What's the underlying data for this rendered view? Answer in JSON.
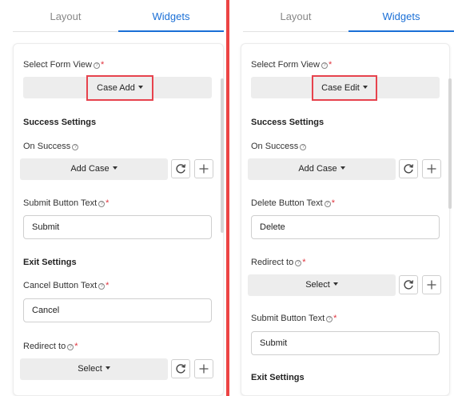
{
  "left": {
    "tabs": [
      {
        "label": "Layout"
      },
      {
        "label": "Widgets"
      }
    ],
    "form_view_label": "Select Form View",
    "form_view_value": "Case Add",
    "success_heading": "Success Settings",
    "on_success_label": "On Success",
    "on_success_value": "Add Case",
    "submit_label": "Submit Button Text",
    "submit_value": "Submit",
    "exit_heading": "Exit Settings",
    "cancel_label": "Cancel Button Text",
    "cancel_value": "Cancel",
    "redirect_label": "Redirect to",
    "redirect_value": "Select"
  },
  "right": {
    "tabs": [
      {
        "label": "Layout"
      },
      {
        "label": "Widgets"
      }
    ],
    "form_view_label": "Select Form View",
    "form_view_value": "Case Edit",
    "success_heading": "Success Settings",
    "on_success_label": "On Success",
    "on_success_value": "Add Case",
    "delete_label": "Delete Button Text",
    "delete_value": "Delete",
    "redirect_label": "Redirect to",
    "redirect_value": "Select",
    "submit_label": "Submit Button Text",
    "submit_value": "Submit",
    "exit_heading": "Exit Settings"
  },
  "colors": {
    "accent": "#1a6fd6",
    "highlight": "#e7434d",
    "divider": "#ec4444",
    "required": "#e0343e"
  },
  "icons": {
    "help": "circle-question-icon",
    "refresh": "refresh-icon",
    "add": "plus-icon",
    "caret": "caret-down-icon"
  }
}
